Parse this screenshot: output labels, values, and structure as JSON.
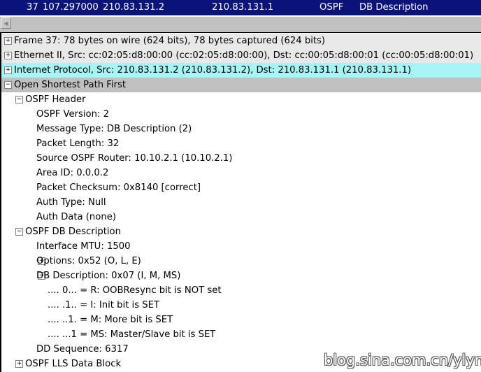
{
  "packet_list_row": {
    "number": "37",
    "time": "107.297000",
    "source": "210.83.131.2",
    "destination": "210.83.131.1",
    "protocol": "OSPF",
    "info": "DB Description"
  },
  "tree": [
    {
      "label": "Frame 37: 78 bytes on wire (624 bits), 78 bytes captured (624 bits)",
      "expander": "+",
      "indent": 0
    },
    {
      "label": "Ethernet II, Src: cc:02:05:d8:00:00 (cc:02:05:d8:00:00), Dst: cc:00:05:d8:00:01 (cc:00:05:d8:00:01)",
      "expander": "+",
      "indent": 0
    },
    {
      "label": "Internet Protocol, Src: 210.83.131.2 (210.83.131.2), Dst: 210.83.131.1 (210.83.131.1)",
      "expander": "+",
      "indent": 0
    },
    {
      "label": "Open Shortest Path First",
      "expander": "−",
      "indent": 0
    },
    {
      "label": "OSPF Header",
      "expander": "−",
      "indent": 1
    },
    {
      "label": "OSPF Version: 2",
      "expander": "",
      "indent": 2
    },
    {
      "label": "Message Type: DB Description (2)",
      "expander": "",
      "indent": 2
    },
    {
      "label": "Packet Length: 32",
      "expander": "",
      "indent": 2
    },
    {
      "label": "Source OSPF Router: 10.10.2.1 (10.10.2.1)",
      "expander": "",
      "indent": 2
    },
    {
      "label": "Area ID: 0.0.0.2",
      "expander": "",
      "indent": 2
    },
    {
      "label": "Packet Checksum: 0x8140 [correct]",
      "expander": "",
      "indent": 2
    },
    {
      "label": "Auth Type: Null",
      "expander": "",
      "indent": 2
    },
    {
      "label": "Auth Data (none)",
      "expander": "",
      "indent": 2
    },
    {
      "label": "OSPF DB Description",
      "expander": "−",
      "indent": 1
    },
    {
      "label": "Interface MTU: 1500",
      "expander": "",
      "indent": 2
    },
    {
      "label": "Options: 0x52 (O, L, E)",
      "expander": "+",
      "indent": 2
    },
    {
      "label": "DB Description: 0x07 (I, M, MS)",
      "expander": "−",
      "indent": 2
    },
    {
      "label": ".... 0... = R: OOBResync bit is NOT set",
      "expander": "",
      "indent": 3
    },
    {
      "label": ".... .1.. = I: Init bit is SET",
      "expander": "",
      "indent": 3
    },
    {
      "label": ".... ..1. = M: More bit is SET",
      "expander": "",
      "indent": 3
    },
    {
      "label": ".... ...1 = MS: Master/Slave bit is SET",
      "expander": "",
      "indent": 3
    },
    {
      "label": "DD Sequence: 6317",
      "expander": "",
      "indent": 2
    },
    {
      "label": "OSPF LLS Data Block",
      "expander": "+",
      "indent": 1
    }
  ],
  "watermark": "blog.sina.com.cn/ylyne",
  "colors": {
    "packet_row_bg": "#0a1478",
    "ip_row_bg": "#a5f5f5",
    "selected_row_bg": "#c0c0c0",
    "alt_row_bg": "#e8e8e8"
  }
}
